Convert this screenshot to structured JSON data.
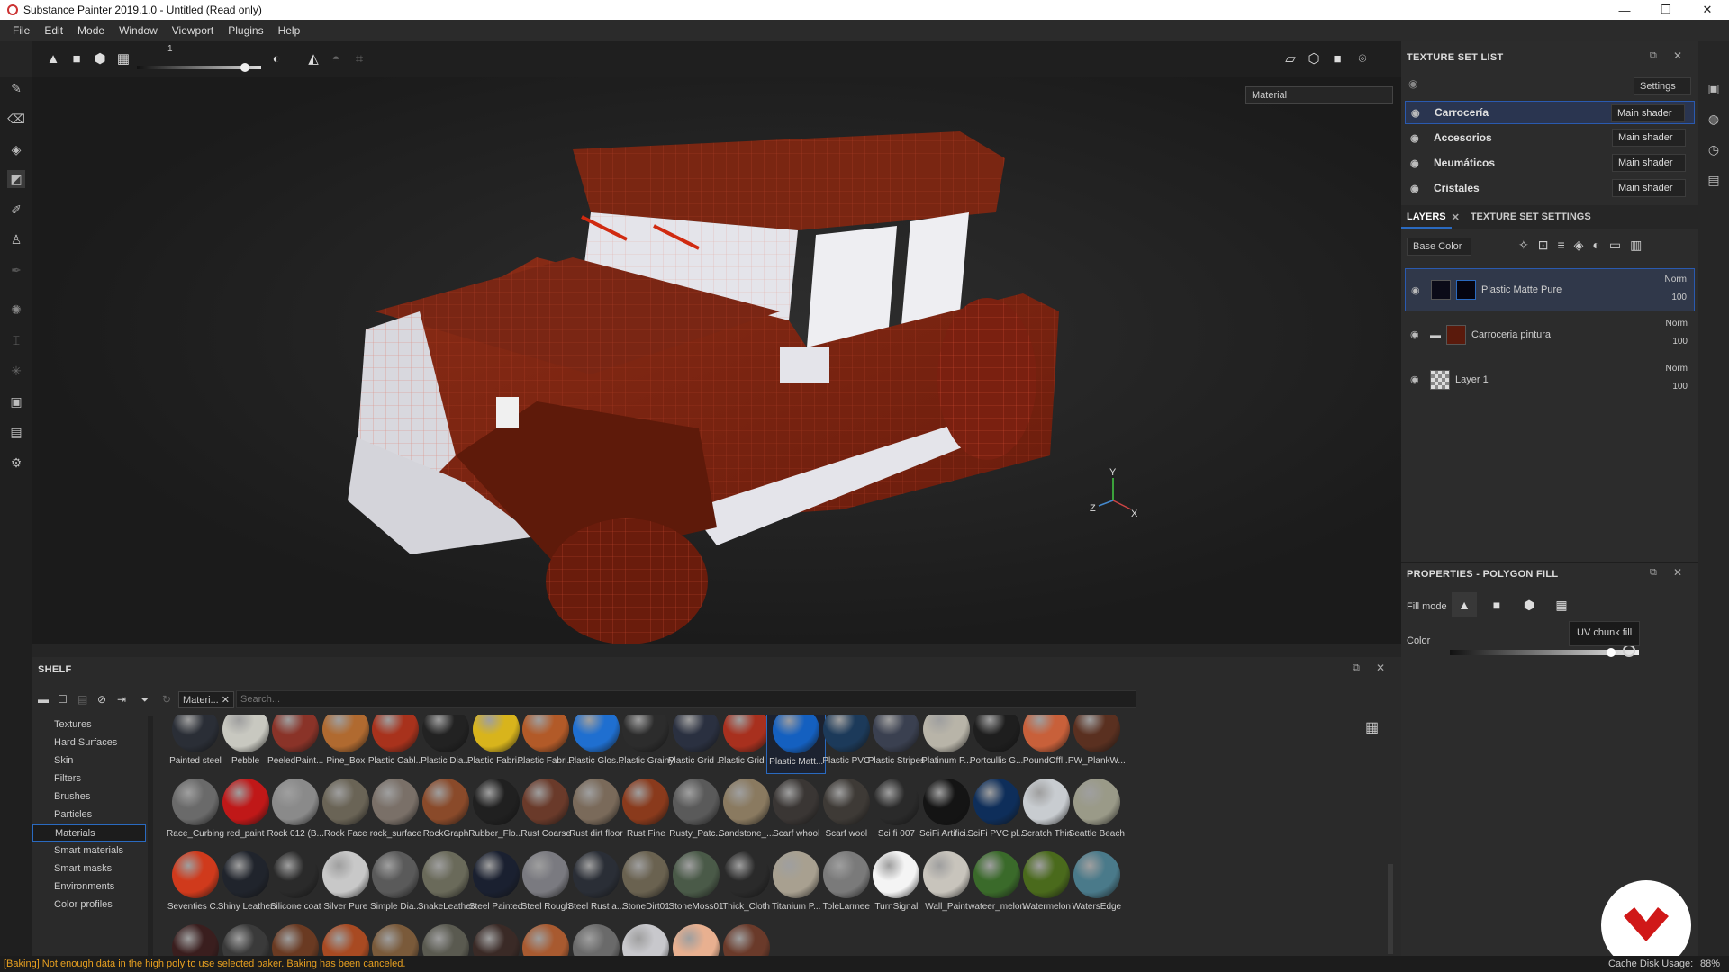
{
  "window": {
    "title": "Substance Painter 2019.1.0 - Untitled (Read only)",
    "minimize": "—",
    "restore": "❐",
    "close": "✕"
  },
  "menu": [
    "File",
    "Edit",
    "Mode",
    "Window",
    "Viewport",
    "Plugins",
    "Help"
  ],
  "toolbar": {
    "size_value": "1",
    "slider_fraction": 0.9
  },
  "viewport": {
    "channel_select": "Material",
    "axis_labels": {
      "y": "Y",
      "z": "Z",
      "x": "X"
    }
  },
  "texture_set_list": {
    "title": "TEXTURE SET LIST",
    "settings_label": "Settings",
    "sets": [
      {
        "name": "Carrocería",
        "shader": "Main shader",
        "selected": true
      },
      {
        "name": "Accesorios",
        "shader": "Main shader"
      },
      {
        "name": "Neumáticos",
        "shader": "Main shader"
      },
      {
        "name": "Cristales",
        "shader": "Main shader"
      }
    ]
  },
  "layers_panel": {
    "tab_layers": "LAYERS",
    "tab_tss": "TEXTURE SET SETTINGS",
    "channel": "Base Color",
    "layers": [
      {
        "name": "Plastic Matte Pure",
        "blend": "Norm",
        "opacity": "100",
        "selected": true,
        "color": "#0b0b18"
      },
      {
        "name": "Carroceria pintura",
        "blend": "Norm",
        "opacity": "100",
        "color": "#5a1a0c"
      },
      {
        "name": "Layer 1",
        "blend": "Norm",
        "opacity": "100",
        "color": "checker"
      }
    ]
  },
  "properties": {
    "title": "PROPERTIES - POLYGON FILL",
    "fill_mode_label": "Fill mode",
    "color_label": "Color",
    "tooltip": "UV chunk fill",
    "color_value": "1"
  },
  "shelf": {
    "title": "SHELF",
    "filter_tag": "Materi...",
    "search_placeholder": "Search...",
    "categories": [
      "Textures",
      "Hard Surfaces",
      "Skin",
      "Filters",
      "Brushes",
      "Particles",
      "Materials",
      "Smart materials",
      "Smart masks",
      "Environments",
      "Color profiles"
    ],
    "selected_category": "Materials",
    "materials": [
      {
        "name": "Painted steel",
        "color": "#2a2e36"
      },
      {
        "name": "Pebble",
        "color": "#c8c8c0"
      },
      {
        "name": "PeeledPaint...",
        "color": "#8a3328"
      },
      {
        "name": "Pine_Box",
        "color": "#b06a30"
      },
      {
        "name": "Plastic Cabl...",
        "color": "#a8321c"
      },
      {
        "name": "Plastic Dia...",
        "color": "#222"
      },
      {
        "name": "Plastic Fabri...",
        "color": "#d8b41c"
      },
      {
        "name": "Plastic Fabri...",
        "color": "#b25a28"
      },
      {
        "name": "Plastic Glos...",
        "color": "#1f6fd0"
      },
      {
        "name": "Plastic Grainy",
        "color": "#2c2c2c"
      },
      {
        "name": "Plastic Grid ...",
        "color": "#2a3040"
      },
      {
        "name": "Plastic Grid ...",
        "color": "#a8301e"
      },
      {
        "name": "Plastic Matt...",
        "color": "#1460c0"
      },
      {
        "name": "Plastic PVC",
        "color": "#1c3a5a"
      },
      {
        "name": "Plastic Stripes",
        "color": "#3a4050"
      },
      {
        "name": "Platinum P...",
        "color": "#b8b4a8"
      },
      {
        "name": "Portcullis G...",
        "color": "#1e1e1e"
      },
      {
        "name": "PoundOffl...",
        "color": "#c8603a"
      },
      {
        "name": "PW_PlankW...",
        "color": "#5a3020"
      },
      {
        "name": "Race_Curbing",
        "color": "#6a6a6a"
      },
      {
        "name": "red_paint",
        "color": "#c01818"
      },
      {
        "name": "Rock 012 (B...",
        "color": "#8a8a8a"
      },
      {
        "name": "Rock Face",
        "color": "#6a6456"
      },
      {
        "name": "rock_surface",
        "color": "#7a7068"
      },
      {
        "name": "RockGraph",
        "color": "#8a4a2a"
      },
      {
        "name": "Rubber_Flo...",
        "color": "#202020"
      },
      {
        "name": "Rust Coarse",
        "color": "#6a3a2a"
      },
      {
        "name": "Rust dirt floor",
        "color": "#7a6a5a"
      },
      {
        "name": "Rust Fine",
        "color": "#8a3a1c"
      },
      {
        "name": "Rusty_Patc...",
        "color": "#5a5a5a"
      },
      {
        "name": "Sandstone_...",
        "color": "#8a7a60"
      },
      {
        "name": "Scarf whool",
        "color": "#3a3634"
      },
      {
        "name": "Scarf wool",
        "color": "#3e3a36"
      },
      {
        "name": "Sci fi 007",
        "color": "#2a2a2a"
      },
      {
        "name": "SciFi Artifici...",
        "color": "#141414"
      },
      {
        "name": "SciFi PVC pl...",
        "color": "#0e2e5a"
      },
      {
        "name": "Scratch Thin",
        "color": "#c8ccd0"
      },
      {
        "name": "Seattle Beach",
        "color": "#9a9a88"
      },
      {
        "name": "Seventies C...",
        "color": "#d03a1c"
      },
      {
        "name": "Shiny Leather",
        "color": "#20242c"
      },
      {
        "name": "Silicone coat",
        "color": "#2a2a2a"
      },
      {
        "name": "Silver Pure",
        "color": "#c8c8c8"
      },
      {
        "name": "Simple Dia...",
        "color": "#5a5a5a"
      },
      {
        "name": "SnakeLeather",
        "color": "#6a6a5a"
      },
      {
        "name": "Steel Painted",
        "color": "#1a2030"
      },
      {
        "name": "Steel Rough",
        "color": "#7a7a80"
      },
      {
        "name": "Steel Rust a...",
        "color": "#2a2e36"
      },
      {
        "name": "StoneDirt01",
        "color": "#6a6250"
      },
      {
        "name": "StoneMoss01",
        "color": "#4a5a48"
      },
      {
        "name": "Thick_Cloth",
        "color": "#2a2a2a"
      },
      {
        "name": "Titanium P...",
        "color": "#a8a090"
      },
      {
        "name": "ToleLarmee",
        "color": "#7a7a7a"
      },
      {
        "name": "TurnSignal",
        "color": "#f4f4f4"
      },
      {
        "name": "Wall_Paint",
        "color": "#c8c4bc"
      },
      {
        "name": "wateer_melon",
        "color": "#3a6a2a"
      },
      {
        "name": "Watermelon",
        "color": "#4a6a1c"
      },
      {
        "name": "WatersEdge",
        "color": "#4a7a8a"
      },
      {
        "name": "",
        "color": "#3a1e1e"
      },
      {
        "name": "",
        "color": "#3a3a3a"
      },
      {
        "name": "",
        "color": "#6a3a22"
      },
      {
        "name": "",
        "color": "#a84a22"
      },
      {
        "name": "",
        "color": "#7a5a3a"
      },
      {
        "name": "",
        "color": "#5a5a50"
      },
      {
        "name": "",
        "color": "#3a2a26"
      },
      {
        "name": "",
        "color": "#a85a30"
      },
      {
        "name": "",
        "color": "#6a6a6a"
      },
      {
        "name": "",
        "color": "#c8c8cc"
      },
      {
        "name": "",
        "color": "#e8b090"
      },
      {
        "name": "",
        "color": "#6a3a2a"
      }
    ]
  },
  "status": {
    "message": "[Baking] Not enough data in the high poly to use selected baker. Baking has been canceled.",
    "cache": "Cache Disk Usage:",
    "cache_value": "88%"
  },
  "colors": {
    "accent": "#1a5ab0",
    "status_text": "#e8a020",
    "car": "#b23a1e"
  }
}
